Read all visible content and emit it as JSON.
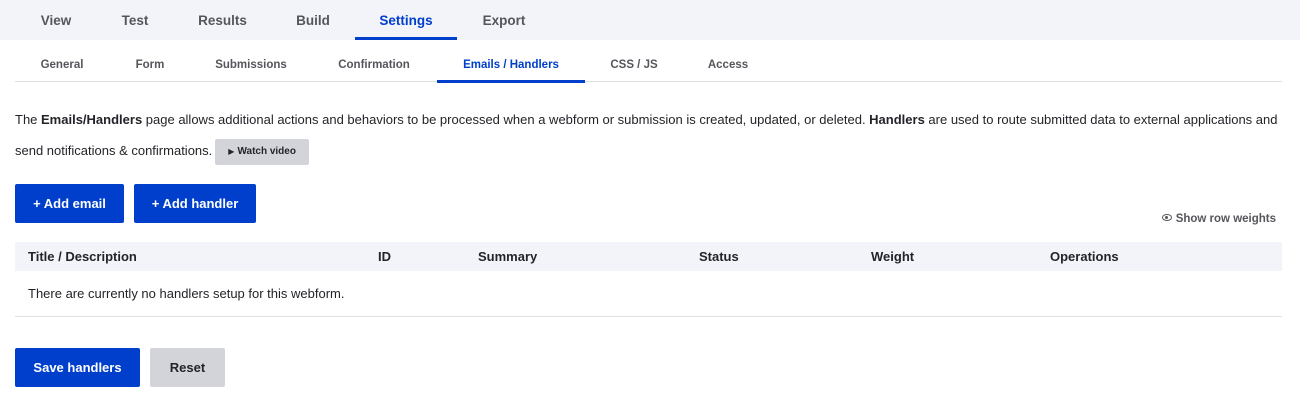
{
  "primary_tabs": [
    {
      "label": "View",
      "active": false
    },
    {
      "label": "Test",
      "active": false
    },
    {
      "label": "Results",
      "active": false
    },
    {
      "label": "Build",
      "active": false
    },
    {
      "label": "Settings",
      "active": true
    },
    {
      "label": "Export",
      "active": false
    }
  ],
  "secondary_tabs": [
    {
      "label": "General",
      "active": false
    },
    {
      "label": "Form",
      "active": false
    },
    {
      "label": "Submissions",
      "active": false
    },
    {
      "label": "Confirmation",
      "active": false
    },
    {
      "label": "Emails / Handlers",
      "active": true
    },
    {
      "label": "CSS / JS",
      "active": false
    },
    {
      "label": "Access",
      "active": false
    }
  ],
  "description": {
    "part1": "The ",
    "bold1": "Emails/Handlers",
    "part2": " page allows additional actions and behaviors to be processed when a webform or submission is created, updated, or deleted. ",
    "bold2": "Handlers",
    "part3": " are used to route submitted data to external applications and send notifications & confirmations.",
    "watch_video": "Watch video"
  },
  "actions": {
    "add_email": "+ Add email",
    "add_handler": "+ Add handler",
    "show_row_weights": "Show row weights"
  },
  "table": {
    "columns": [
      "Title / Description",
      "ID",
      "Summary",
      "Status",
      "Weight",
      "Operations"
    ],
    "empty_message": "There are currently no handlers setup for this webform."
  },
  "form_actions": {
    "save": "Save handlers",
    "reset": "Reset"
  },
  "colors": {
    "accent": "#003ecc",
    "tab_bar_bg": "#f3f4f9",
    "secondary_button_bg": "#d3d4d9"
  }
}
